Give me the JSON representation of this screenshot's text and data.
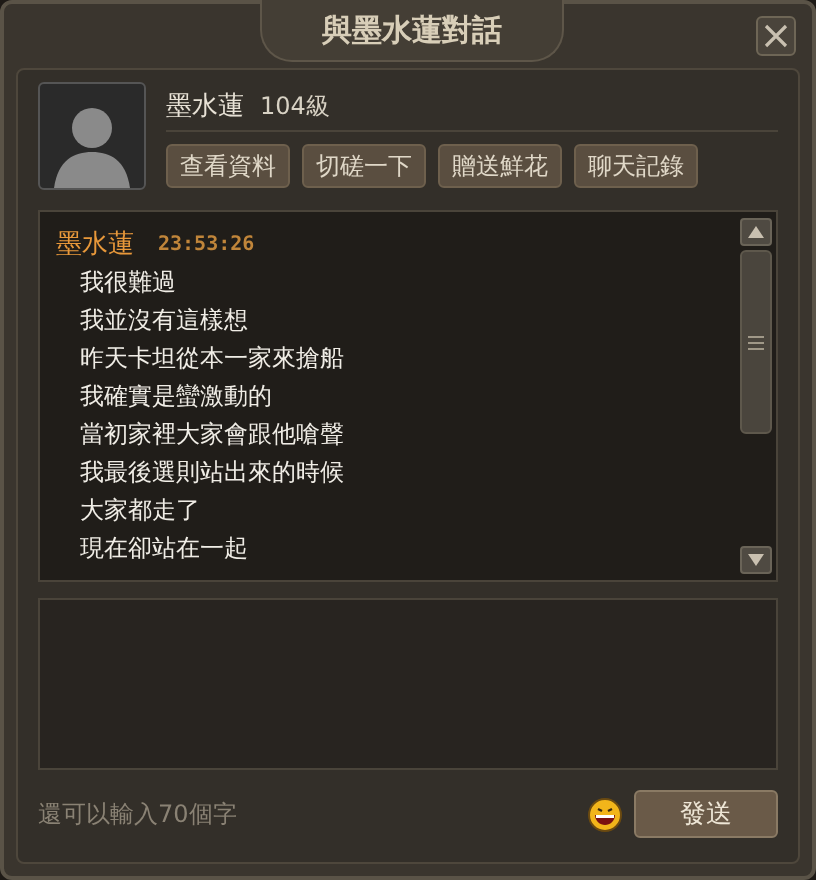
{
  "window": {
    "title": "與墨水蓮對話"
  },
  "contact": {
    "name": "墨水蓮",
    "level": "104級"
  },
  "actions": [
    "查看資料",
    "切磋一下",
    "贈送鮮花",
    "聊天記錄"
  ],
  "messages": [
    {
      "sender": "墨水蓮",
      "time": "23:53:26",
      "lines": [
        "我很難過",
        "我並沒有這樣想",
        "昨天卡坦從本一家來搶船",
        "我確實是蠻激動的",
        "當初家裡大家會跟他嗆聲",
        "我最後選則站出來的時候",
        "大家都走了",
        "現在卻站在一起"
      ]
    }
  ],
  "composer": {
    "remaining": "還可以輸入70個字",
    "send": "發送"
  }
}
